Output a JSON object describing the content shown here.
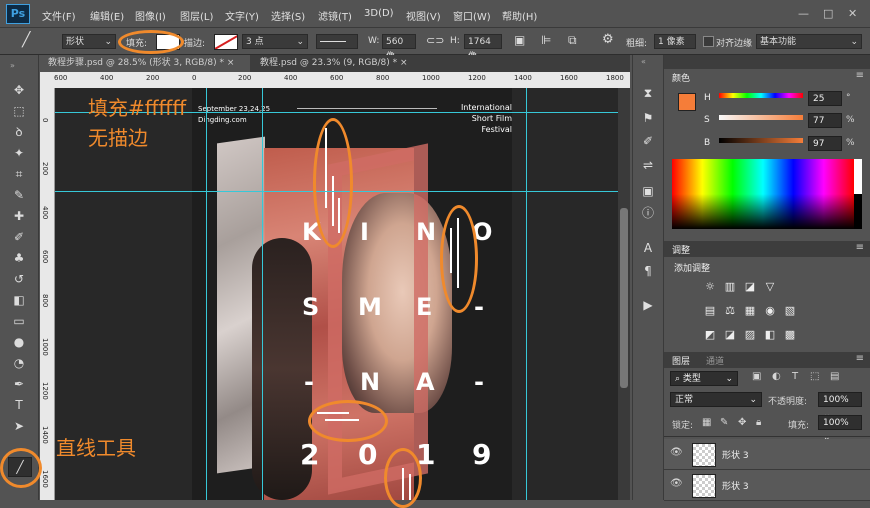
{
  "app": {
    "logo": "Ps",
    "window_controls": [
      "—",
      "□",
      "✕"
    ]
  },
  "menu": [
    "文件(F)",
    "编辑(E)",
    "图像(I)",
    "图层(L)",
    "文字(Y)",
    "选择(S)",
    "滤镜(T)",
    "3D(D)",
    "视图(V)",
    "窗口(W)",
    "帮助(H)"
  ],
  "options": {
    "mode": "形状",
    "fill_label": "填充:",
    "fill_color": "#ffffff",
    "stroke_label": "描边:",
    "stroke_size": "3 点",
    "w_label": "W:",
    "w_value": "560 像",
    "h_label": "H:",
    "h_value": "1764 像",
    "weight_label": "粗细:",
    "weight_value": "1 像素",
    "align_edges": "对齐边缘",
    "workspace": "基本功能"
  },
  "tabs": [
    {
      "label": "教程步骤.psd @ 28.5% (形状 3, RGB/8) *",
      "close": "×"
    },
    {
      "label": "教程.psd @ 23.3% (9, RGB/8) *",
      "close": "×"
    }
  ],
  "ruler": {
    "top": [
      "600",
      "400",
      "200",
      "0",
      "200",
      "400",
      "600",
      "800",
      "1000",
      "1200",
      "1400",
      "1600",
      "1800"
    ],
    "left": [
      "0",
      "2 0 0",
      "4 0 0",
      "6 0 0",
      "8 0 0",
      "1 0 0 0",
      "1 2 0 0",
      "1 4 0 0",
      "1 6 0 0"
    ]
  },
  "poster": {
    "date": "September 23,24,25",
    "site": "Dingding.com",
    "festival": [
      "International",
      "Short Film",
      "Festival"
    ],
    "kino_rows": [
      [
        "K",
        "I",
        "N",
        "O"
      ],
      [
        "S",
        "M",
        "E",
        "-"
      ],
      [
        "-",
        "N",
        "A",
        "-"
      ],
      [
        "2",
        "0",
        "1",
        "9"
      ]
    ],
    "accent": "#d06c64"
  },
  "annotations": {
    "fill_note_line1": "填充#ffffff",
    "fill_note_line2": "无描边",
    "tool_note": "直线工具",
    "color": "#f08a2c"
  },
  "color_panel": {
    "title": "颜色",
    "channels": [
      {
        "label": "H",
        "value": "25",
        "unit": "°"
      },
      {
        "label": "S",
        "value": "77",
        "unit": "%"
      },
      {
        "label": "B",
        "value": "97",
        "unit": "%"
      }
    ],
    "foreground": "#f57d39",
    "background": "#ffffff"
  },
  "adjust_panel": {
    "title": "调整",
    "subtitle": "添加调整",
    "icons": [
      "☼",
      "▥",
      "◪",
      "▽",
      "▤",
      "⚖",
      "▦",
      "◉",
      "▧",
      "◩",
      "◪",
      "▨",
      "◧",
      "▩",
      "▭"
    ]
  },
  "layers_panel": {
    "tab_layers": "图层",
    "tab_channels": "通道",
    "filter": "类型",
    "blend_mode": "正常",
    "opacity_label": "不透明度:",
    "opacity_value": "100%",
    "lock_label": "锁定:",
    "fill_label": "填充:",
    "fill_value": "100%",
    "layers": [
      {
        "name": "形状 3"
      },
      {
        "name": "形状 3"
      }
    ]
  }
}
